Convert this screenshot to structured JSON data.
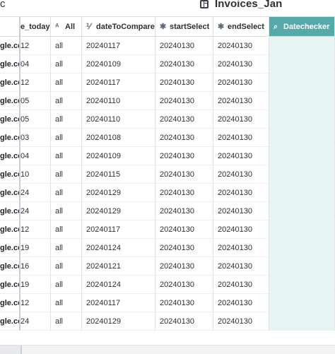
{
  "window": {
    "left_label": "c",
    "title": "Invoices_Jan"
  },
  "columns": [
    {
      "label": "",
      "icon": ""
    },
    {
      "label": "e_today",
      "icon": ""
    },
    {
      "label": "All",
      "icon": "text-type-icon"
    },
    {
      "label": "dateToCompare",
      "icon": "number-type-icon"
    },
    {
      "label": "startSelect",
      "icon": "asterisk-icon"
    },
    {
      "label": "endSelect",
      "icon": "asterisk-icon"
    },
    {
      "label": "Datechecker",
      "icon": "search-icon"
    }
  ],
  "rows": [
    [
      "gle.cc",
      "12",
      "all",
      "20240117",
      "20240130",
      "20240130"
    ],
    [
      "gle.cc",
      "04",
      "all",
      "20240109",
      "20240130",
      "20240130"
    ],
    [
      "gle.cc",
      "12",
      "all",
      "20240117",
      "20240130",
      "20240130"
    ],
    [
      "gle.cc",
      "05",
      "all",
      "20240110",
      "20240130",
      "20240130"
    ],
    [
      "gle.cc",
      "05",
      "all",
      "20240110",
      "20240130",
      "20240130"
    ],
    [
      "gle.cc",
      "03",
      "all",
      "20240108",
      "20240130",
      "20240130"
    ],
    [
      "gle.cc",
      "04",
      "all",
      "20240109",
      "20240130",
      "20240130"
    ],
    [
      "gle.cc",
      "10",
      "all",
      "20240115",
      "20240130",
      "20240130"
    ],
    [
      "gle.cc",
      "24",
      "all",
      "20240129",
      "20240130",
      "20240130"
    ],
    [
      "gle.cc",
      "24",
      "all",
      "20240129",
      "20240130",
      "20240130"
    ],
    [
      "gle.cc",
      "12",
      "all",
      "20240117",
      "20240130",
      "20240130"
    ],
    [
      "gle.cc",
      "19",
      "all",
      "20240124",
      "20240130",
      "20240130"
    ],
    [
      "gle.cc",
      "16",
      "all",
      "20240121",
      "20240130",
      "20240130"
    ],
    [
      "gle.cc",
      "19",
      "all",
      "20240124",
      "20240130",
      "20240130"
    ],
    [
      "gle.cc",
      "12",
      "all",
      "20240117",
      "20240130",
      "20240130"
    ],
    [
      "gle.cc",
      "24",
      "all",
      "20240129",
      "20240130",
      "20240130"
    ]
  ]
}
